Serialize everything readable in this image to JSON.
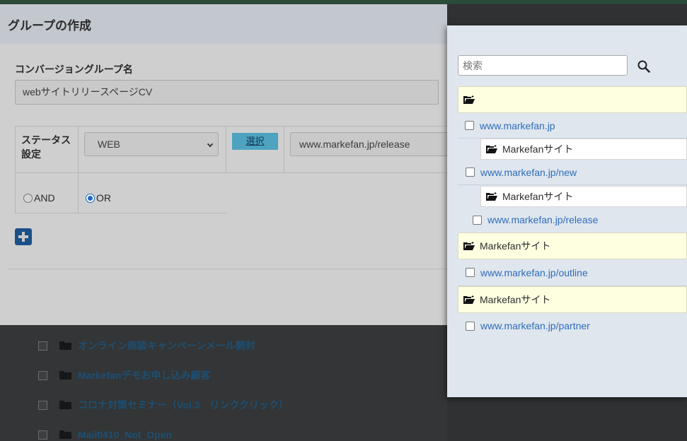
{
  "background_list": {
    "items": [
      {
        "label": "オンライン商談キャンペーンメール開封"
      },
      {
        "label": "Markefanデモお申し込み顧客"
      },
      {
        "label": "コロナ対策セミナー（Vol.3　リンククリック）"
      },
      {
        "label": "Mail0410_Not_Open"
      }
    ]
  },
  "dialog": {
    "title": "グループの作成",
    "name_label": "コンバージョングループ名",
    "name_value": "webサイトリリースページCV",
    "status_label": "ステータス設定",
    "status_value": "WEB",
    "select_button": "選択",
    "url_value": "www.markefan.jp/release",
    "radio_and": "AND",
    "radio_or": "OR",
    "radio_selected": "OR"
  },
  "panel": {
    "search_placeholder": "検索",
    "tree": [
      {
        "type": "folder",
        "label": ""
      },
      {
        "type": "url",
        "label": "www.markefan.jp"
      },
      {
        "type": "subfolder",
        "label": "Markefanサイト"
      },
      {
        "type": "url",
        "label": "www.markefan.jp/new"
      },
      {
        "type": "subfolder",
        "label": "Markefanサイト"
      },
      {
        "type": "url",
        "label": "www.markefan.jp/release"
      },
      {
        "type": "folder",
        "label": "Markefanサイト"
      },
      {
        "type": "url",
        "label": "www.markefan.jp/outline"
      },
      {
        "type": "folder",
        "label": "Markefanサイト"
      },
      {
        "type": "url",
        "label": "www.markefan.jp/partner"
      }
    ]
  },
  "colors": {
    "link": "#2e6dbb",
    "folder_row": "#fefee0",
    "panel_bg": "#dfe6ee",
    "select_button": "#4da3c0",
    "add_button": "#1b4f88",
    "radio_selected": "#1e66c8"
  },
  "icons": {
    "folder": "open-folder-icon",
    "search": "search-icon",
    "add": "plus-square-icon"
  }
}
